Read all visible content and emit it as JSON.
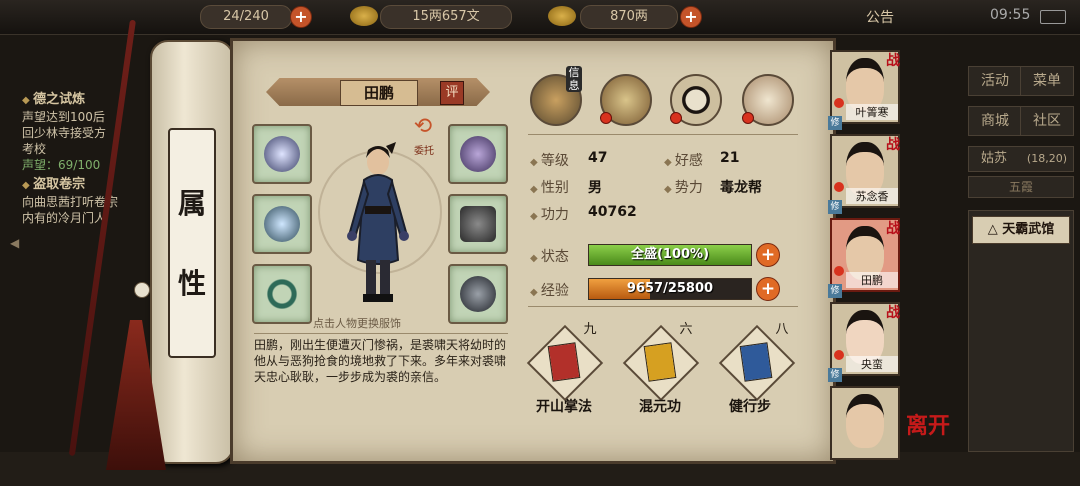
{
  "topbar": {
    "stamina": "24/240",
    "copper": "15两657文",
    "silver": "870两",
    "notice": "公告",
    "time": "09:55"
  },
  "quest": {
    "q1_title": "德之试炼",
    "q1_lines": [
      "声望达到100后",
      "回少林寺接受方",
      "考校"
    ],
    "q1_progress_label": "声望：",
    "q1_progress": "69/100",
    "q2_title": "盗取卷宗",
    "q2_lines": [
      "向曲思茜打听卷宗",
      "内有的冷月门人"
    ]
  },
  "side_menu": {
    "activity": "活动",
    "menu": "菜单",
    "shop": "商城",
    "community": "社区",
    "location": "姑苏",
    "coords": "(18,20)",
    "region": "五霞",
    "place": "天霸武馆"
  },
  "panel": {
    "tab_label_chars": [
      "属",
      "性"
    ],
    "name": "田鹏",
    "rate": "评",
    "trust": "委托",
    "dress_hint": "点击人物更换服饰",
    "bio": "田鹏，刚出生便遭灭门惨祸，是裘啸天将幼时的他从与恶狗抢食的境地救了下来。多年来对裘啸天忠心耿耿，一步步成为裘的亲信。",
    "info_badge": "信息"
  },
  "stats": {
    "level_label": "等级",
    "level": "47",
    "favor_label": "好感",
    "favor": "21",
    "gender_label": "性别",
    "gender": "男",
    "faction_label": "势力",
    "faction": "毒龙帮",
    "power_label": "功力",
    "power": "40762",
    "state_label": "状态",
    "state": "全盛(100%)",
    "state_pct": 1.0,
    "exp_label": "经验",
    "exp": "9657/25800",
    "exp_pct": 0.374
  },
  "skills": [
    {
      "name": "开山掌法",
      "level": "九",
      "color": "#b2302a"
    },
    {
      "name": "混元功",
      "level": "六",
      "color": "#d6a021"
    },
    {
      "name": "健行步",
      "level": "八",
      "color": "#2f5a9a"
    }
  ],
  "roster": [
    {
      "name": "叶箐寒",
      "war": "战",
      "xiu": "修"
    },
    {
      "name": "苏念香",
      "war": "战",
      "xiu": "修"
    },
    {
      "name": "田鹏",
      "war": "战",
      "xiu": "修"
    },
    {
      "name": "央蛮",
      "war": "战",
      "xiu": "修"
    },
    {
      "name": "",
      "war": "",
      "xiu": ""
    }
  ],
  "leave": "离开"
}
